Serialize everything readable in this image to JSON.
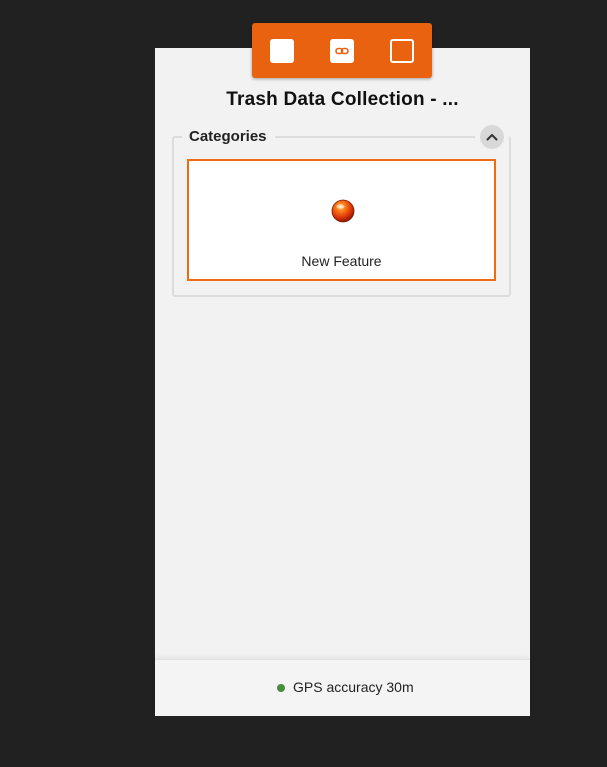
{
  "survey": {
    "title": "Trash Data Collection - ..."
  },
  "toolbar": {
    "background_color": "#e8620f",
    "buttons": [
      {
        "icon": "square-icon"
      },
      {
        "icon": "link-icon"
      },
      {
        "icon": "frame-icon"
      }
    ]
  },
  "categories": {
    "label": "Categories",
    "collapse_icon": "chevron-up-icon",
    "items": [
      {
        "label": "New Feature",
        "icon": "red-sphere-icon",
        "border_color": "#ef6c13"
      }
    ]
  },
  "footer": {
    "gps_status": "GPS accuracy 30m",
    "gps_dot_color": "#4a8c3f"
  }
}
